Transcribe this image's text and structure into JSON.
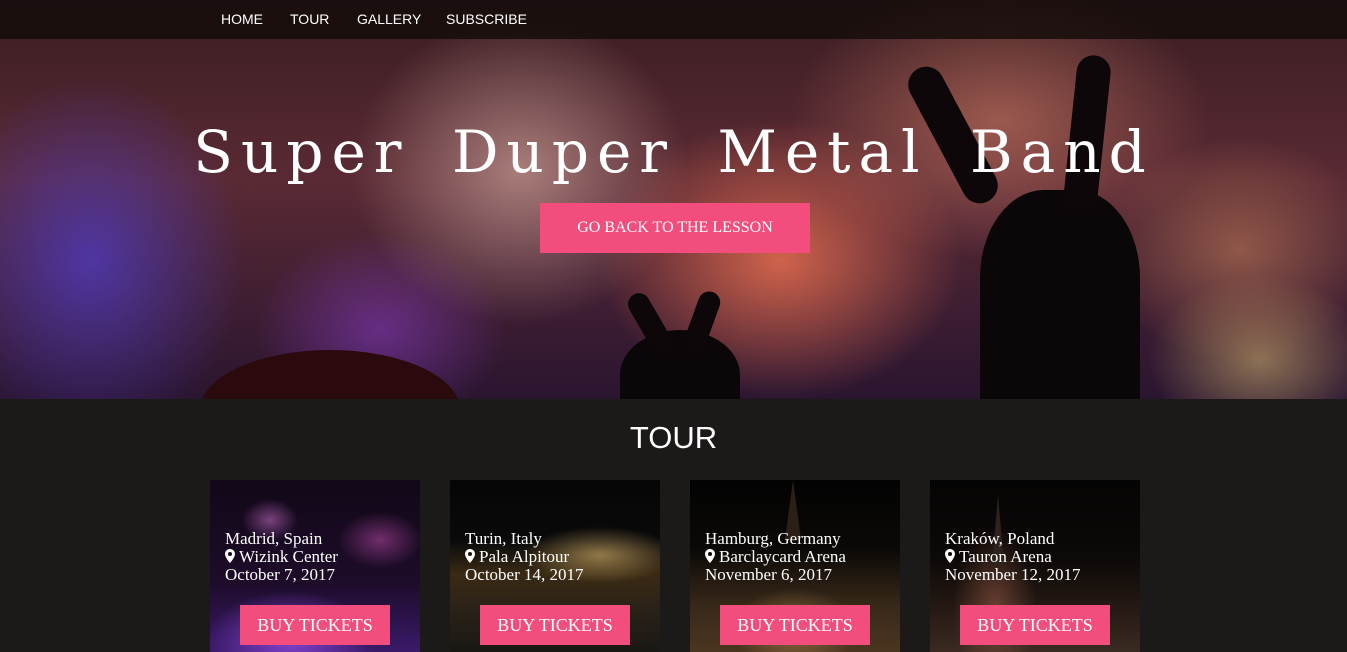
{
  "nav": {
    "items": [
      {
        "label": "HOME"
      },
      {
        "label": "TOUR"
      },
      {
        "label": "GALLERY"
      },
      {
        "label": "SUBSCRIBE"
      }
    ]
  },
  "hero": {
    "title": "Super Duper Metal Band",
    "button_label": "GO BACK TO THE LESSON"
  },
  "tour": {
    "heading": "TOUR",
    "buy_label": "BUY TICKETS",
    "events": [
      {
        "city": "Madrid, Spain",
        "venue": "Wizink Center",
        "date": "October 7, 2017"
      },
      {
        "city": "Turin, Italy",
        "venue": "Pala Alpitour",
        "date": "October 14, 2017"
      },
      {
        "city": "Hamburg, Germany",
        "venue": "Barclaycard Arena",
        "date": "November 6, 2017"
      },
      {
        "city": "Kraków, Poland",
        "venue": "Tauron Arena",
        "date": "November 12, 2017"
      }
    ]
  },
  "colors": {
    "accent": "#f24d7c",
    "background": "#1c1a19"
  }
}
